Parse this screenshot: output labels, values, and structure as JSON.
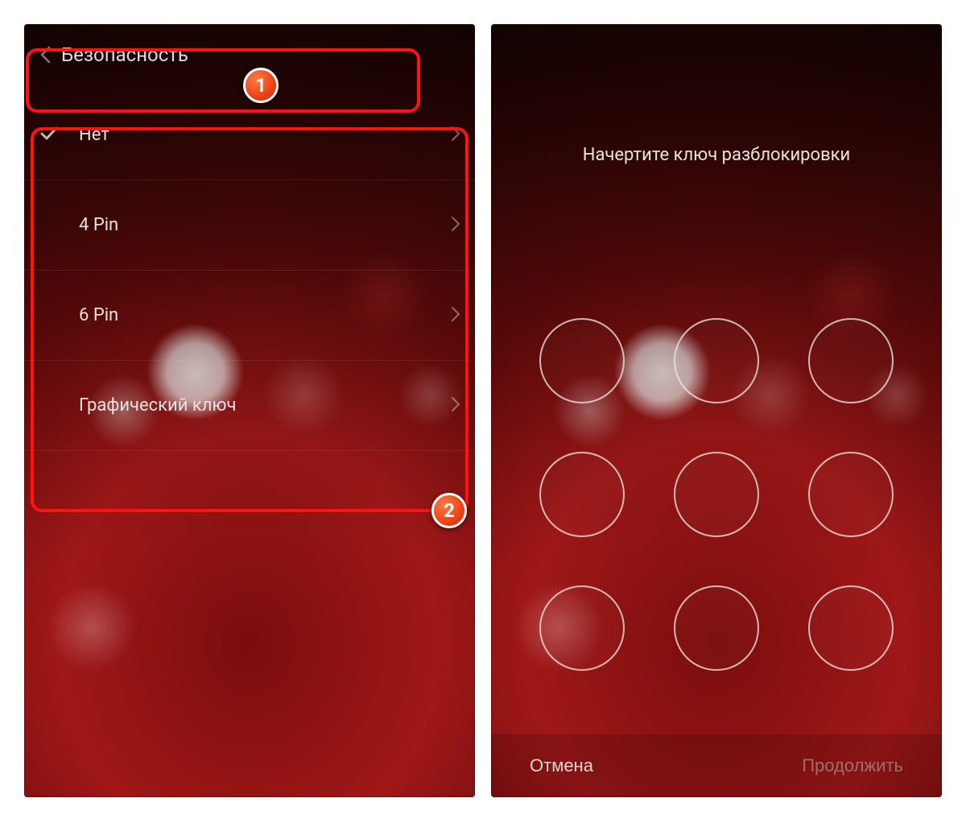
{
  "callouts": {
    "badge1": "1",
    "badge2": "2"
  },
  "left": {
    "header_title": "Безопасность",
    "options": [
      {
        "label": "Нет",
        "selected": true
      },
      {
        "label": "4 Pin",
        "selected": false
      },
      {
        "label": "6 Pin",
        "selected": false
      },
      {
        "label": "Графический ключ",
        "selected": false
      }
    ]
  },
  "right": {
    "instruction": "Начертите ключ разблокировки",
    "cancel_label": "Отмена",
    "continue_label": "Продолжить"
  },
  "colors": {
    "callout_border": "#ff1212",
    "callout_badge": "#e83a10"
  }
}
